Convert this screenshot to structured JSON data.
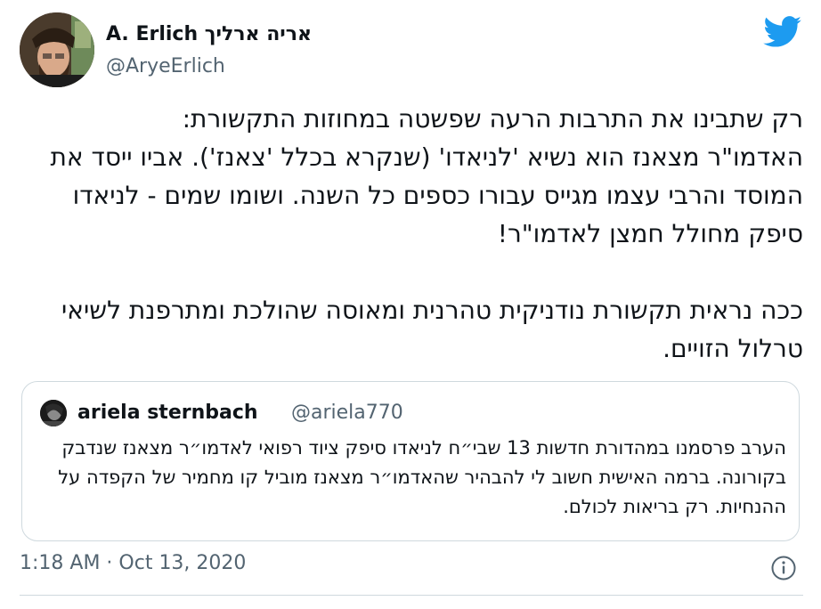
{
  "author": {
    "display_name": "A. Erlich אריה ארליך",
    "handle": "@AryeErlich"
  },
  "tweet": {
    "text": "רק שתבינו את התרבות הרעה שפשטה במחוזות התקשורת:\nהאדמו\"ר מצאנז הוא נשיא 'לניאדו' (שנקרא בכלל 'צאנז'). אביו ייסד את המוסד והרבי עצמו מגייס עבורו כספים כל השנה. ושומו שמים - לניאדו סיפק מחולל חמצן לאדמו\"ר!\n\nככה נראית תקשורת נודניקית טהרנית ומאוסה שהולכת ומתרפנת לשיאי טרלול הזויים."
  },
  "quoted_tweet": {
    "display_name": "ariela sternbach",
    "handle": "@ariela770",
    "text": "הערב פרסמנו במהדורת חדשות 13 שבי״ח לניאדו סיפק ציוד רפואי לאדמו״ר מצאנז שנדבק בקורונה. ברמה האישית חשוב לי להבהיר שהאדמו״ר מצאנז מוביל קו מחמיר של הקפדה על ההנחיות. רק בריאות לכולם."
  },
  "timestamp": "1:18 AM · Oct 13, 2020",
  "icons": {
    "logo": "twitter-bird-icon",
    "info": "info-icon"
  },
  "colors": {
    "twitter_blue": "#1d9bf0",
    "secondary_text": "#536471",
    "border": "#cfd9de"
  }
}
